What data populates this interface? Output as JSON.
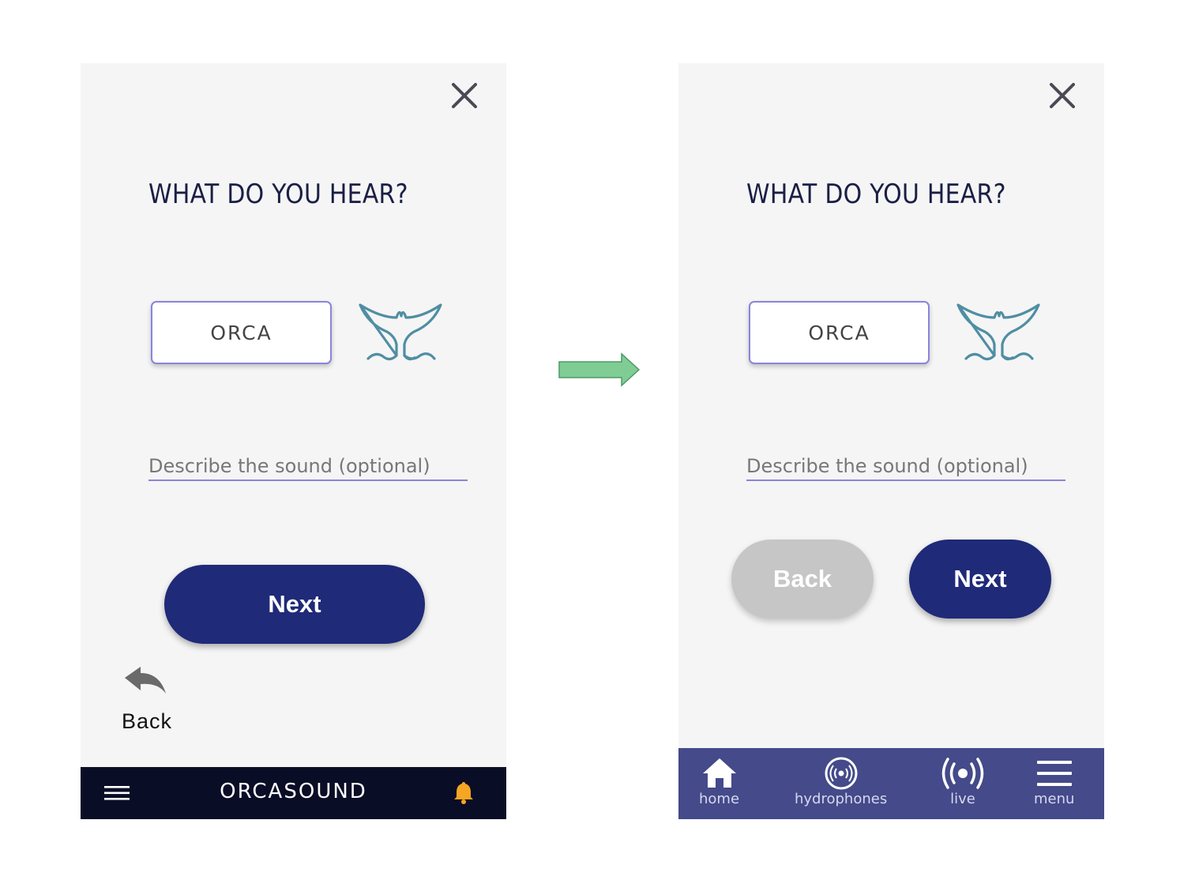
{
  "colors": {
    "navy_button": "#1f2a78",
    "option_border": "#8a84dc",
    "back_disabled": "#c6c6c6",
    "dark_bar": "#0a0d26",
    "nav_bar": "#444a8a",
    "bell": "#f5a623",
    "tail_icon": "#4f8ea3",
    "arrow": "#7fcc95"
  },
  "left_screen": {
    "question": "WHAT DO YOU HEAR?",
    "option_label": "ORCA",
    "describe_placeholder": "Describe the sound (optional)",
    "next_label": "Next",
    "back_label": "Back",
    "brand": "ORCASOUND",
    "icons": [
      "close-icon",
      "whale-tail-icon",
      "back-arrow-icon",
      "hamburger-icon",
      "bell-icon"
    ]
  },
  "right_screen": {
    "question": "WHAT DO YOU HEAR?",
    "option_label": "ORCA",
    "describe_placeholder": "Describe the sound (optional)",
    "back_label": "Back",
    "next_label": "Next",
    "nav": [
      {
        "label": "home",
        "icon": "home-icon"
      },
      {
        "label": "hydrophones",
        "icon": "hydrophone-icon"
      },
      {
        "label": "live",
        "icon": "live-icon"
      },
      {
        "label": "menu",
        "icon": "menu-icon"
      }
    ]
  }
}
